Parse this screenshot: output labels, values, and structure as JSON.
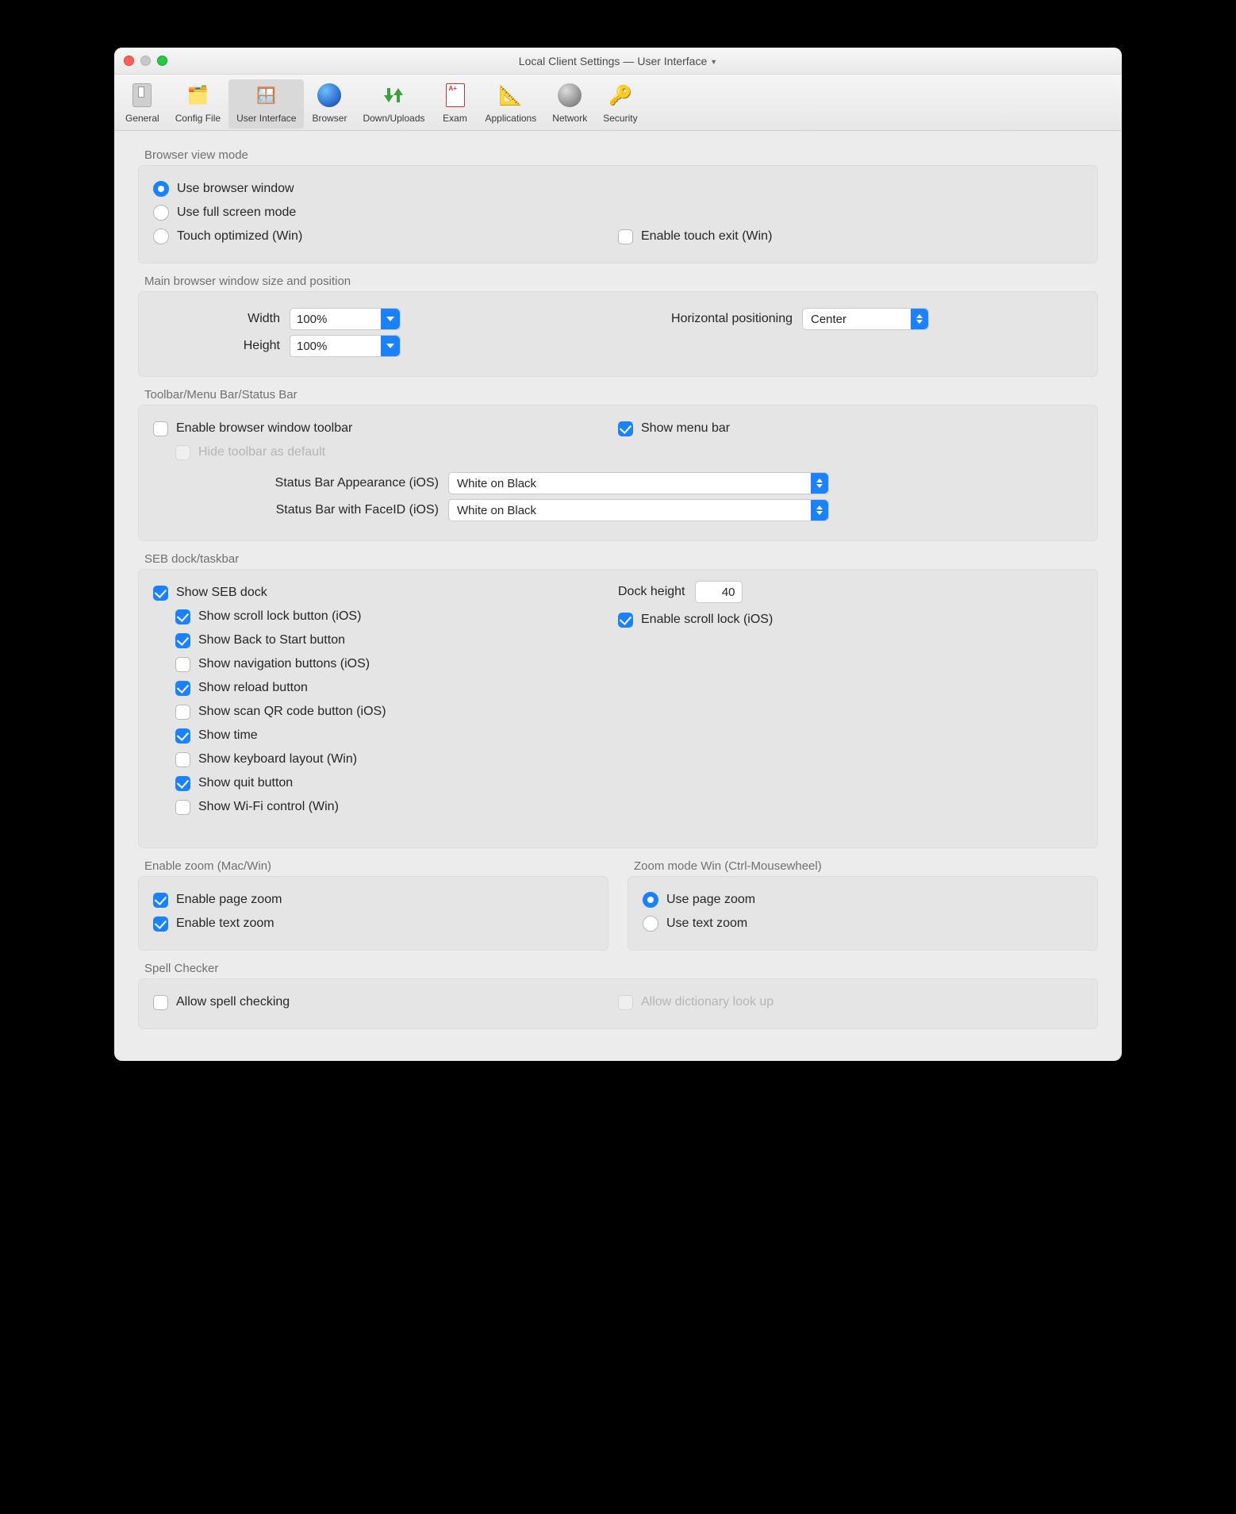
{
  "window_title_prefix": "Local Client Settings  —  ",
  "window_title_tab": "User Interface",
  "toolbar": [
    {
      "label": "General"
    },
    {
      "label": "Config File"
    },
    {
      "label": "User Interface"
    },
    {
      "label": "Browser"
    },
    {
      "label": "Down/Uploads"
    },
    {
      "label": "Exam"
    },
    {
      "label": "Applications"
    },
    {
      "label": "Network"
    },
    {
      "label": "Security"
    }
  ],
  "groups": {
    "view_mode": {
      "title": "Browser view mode",
      "opts": [
        {
          "label": "Use browser window",
          "checked": true
        },
        {
          "label": "Use full screen mode",
          "checked": false
        },
        {
          "label": "Touch optimized (Win)",
          "checked": false
        }
      ],
      "enable_touch_exit": {
        "label": "Enable touch exit (Win)",
        "checked": false
      }
    },
    "size": {
      "title": "Main browser window size and position",
      "width": {
        "label": "Width",
        "value": "100%"
      },
      "height": {
        "label": "Height",
        "value": "100%"
      },
      "hpos": {
        "label": "Horizontal positioning",
        "value": "Center"
      }
    },
    "bars": {
      "title": "Toolbar/Menu Bar/Status Bar",
      "enable_toolbar": {
        "label": "Enable browser window toolbar",
        "checked": false
      },
      "hide_toolbar": {
        "label": "Hide toolbar as default",
        "disabled": true
      },
      "show_menu": {
        "label": "Show menu bar",
        "checked": true
      },
      "status_ios": {
        "label": "Status Bar Appearance (iOS)",
        "value": "White on Black"
      },
      "status_faceid": {
        "label": "Status Bar with FaceID (iOS)",
        "value": "White on Black"
      }
    },
    "dock": {
      "title": "SEB dock/taskbar",
      "show_dock": {
        "label": "Show SEB dock",
        "checked": true
      },
      "children": [
        {
          "label": "Show scroll lock button (iOS)",
          "checked": true
        },
        {
          "label": "Show Back to Start button",
          "checked": true
        },
        {
          "label": "Show navigation buttons (iOS)",
          "checked": false
        },
        {
          "label": "Show reload button",
          "checked": true
        },
        {
          "label": "Show scan QR code button (iOS)",
          "checked": false
        },
        {
          "label": "Show time",
          "checked": true
        },
        {
          "label": "Show keyboard layout (Win)",
          "checked": false
        },
        {
          "label": "Show quit button",
          "checked": true
        },
        {
          "label": "Show Wi-Fi control (Win)",
          "checked": false
        }
      ],
      "dock_height": {
        "label": "Dock height",
        "value": "40"
      },
      "enable_scroll_lock": {
        "label": "Enable scroll lock (iOS)",
        "checked": true
      }
    },
    "zoom": {
      "title": "Enable zoom (Mac/Win)",
      "page": {
        "label": "Enable page zoom",
        "checked": true
      },
      "text": {
        "label": "Enable text zoom",
        "checked": true
      }
    },
    "zoom_mode": {
      "title": "Zoom mode Win (Ctrl-Mousewheel)",
      "opts": [
        {
          "label": "Use page zoom",
          "checked": true
        },
        {
          "label": "Use text zoom",
          "checked": false
        }
      ]
    },
    "spell": {
      "title": "Spell Checker",
      "allow": {
        "label": "Allow spell checking",
        "checked": false
      },
      "dict": {
        "label": "Allow dictionary look up",
        "disabled": true
      }
    }
  }
}
